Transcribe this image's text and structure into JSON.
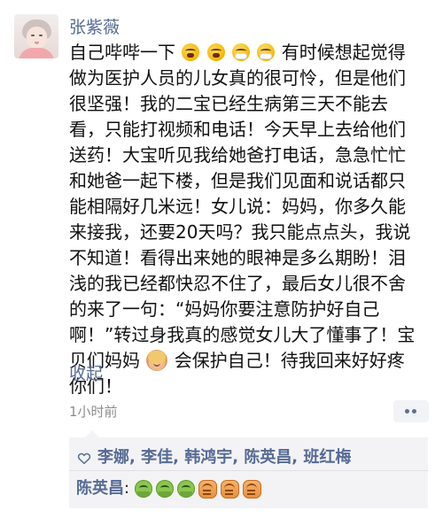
{
  "post": {
    "author": "张紫薇",
    "content_parts": [
      "自己哔哔一下",
      "有时候想起觉得做为医护人员的儿女真的很可怜，但是他们很坚强！我的二宝已经生病第三天不能去看，只能打视频和电话！今天早上去给他们送药！大宝听见我给她爸打电话，急急忙忙和她爸一起下楼，但是我们见面和说话都只能相隔好几米远！女儿说：妈妈，你多久能来接我，还要20天吗？我只能点点头，我说不知道！看得出来她的眼神是多么期盼！泪浅的我已经都快忍不住了，最后女儿很不舍的来了一句：“妈妈你要注意防护好自己啊！”转过身我真的感觉女儿大了懂事了！宝贝们妈妈",
      "会保护自己！待我回来好好疼你们！"
    ],
    "collapse_label": "收起",
    "time": "1小时前",
    "likes": "李娜, 李佳, 韩鸿宇, 陈英昌, 班红梅",
    "comment": {
      "author": "陈英昌",
      "separator": ":"
    }
  },
  "colors": {
    "link": "#576b95",
    "text": "#111111",
    "meta": "#8c8c8c",
    "panel": "#f3f3f5"
  },
  "icons": {
    "like": "heart-icon",
    "more": "ellipsis-icon"
  }
}
